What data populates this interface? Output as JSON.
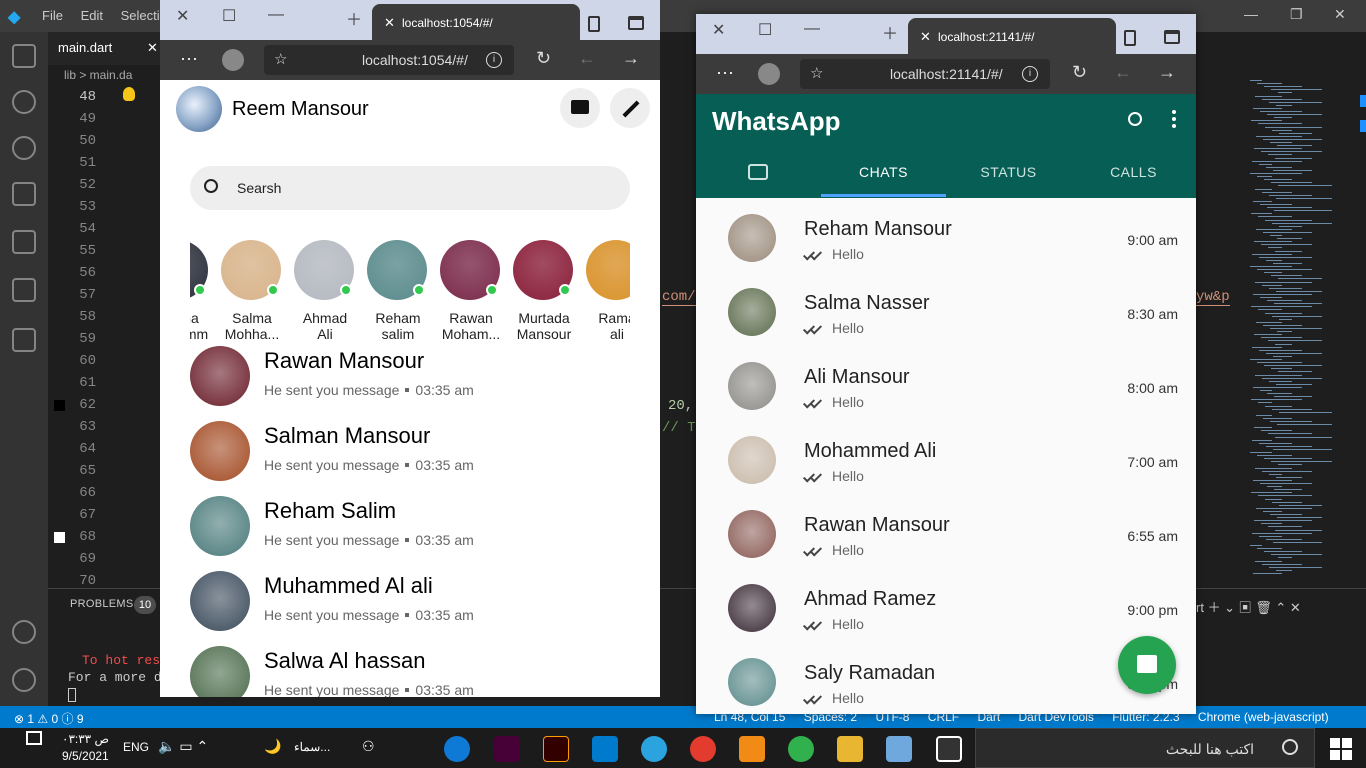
{
  "vscode": {
    "menu": [
      "File",
      "Edit",
      "Selectio"
    ],
    "tab": "main.dart",
    "breadcrumb": "lib > main.da",
    "line_numbers": [
      "48",
      "49",
      "50",
      "51",
      "52",
      "53",
      "54",
      "55",
      "56",
      "57",
      "58",
      "59",
      "60",
      "61",
      "62",
      "63",
      "64",
      "65",
      "66",
      "67",
      "68",
      "69",
      "70"
    ],
    "code_fragments": {
      "url_left": "com/",
      "url_right": "yw&p",
      "number": "20,",
      "comment": "// T"
    },
    "panel": {
      "problems_label": "PROBLEMS",
      "problems_count": "10",
      "terminal_line1": "To hot rest",
      "terminal_line2": "For a more de",
      "ctl_text": "rt"
    },
    "status_left": "⊗ 1 ⚠ 0 ⓘ 9",
    "status_right": [
      "Ln 48, Col 15",
      "Spaces: 2",
      "UTF-8",
      "CRLF",
      "Dart",
      "Dart DevTools",
      "Flutter: 2.2.3",
      "Chrome (web-javascript)"
    ]
  },
  "taskbar": {
    "time": "ص ٠٣:٣٣",
    "date": "9/5/2021",
    "lang": "ENG",
    "news": "سماء...",
    "search_placeholder": "اكتب هنا للبحث"
  },
  "browser1": {
    "tab_url": "localhost:1054/#/",
    "address": "localhost:1054/#/"
  },
  "browser2": {
    "tab_url": "localhost:21141/#/",
    "address": "localhost:21141/#/"
  },
  "messenger": {
    "user_name": "Reem Mansour",
    "search_placeholder": "Searsh",
    "stories": [
      {
        "l1": "Salma",
        "l2": "Mohamm",
        "color": "#2b2f3a"
      },
      {
        "l1": "Salma",
        "l2": "Mohha...",
        "color": "#d8b38a"
      },
      {
        "l1": "Ahmad",
        "l2": "Ali",
        "color": "#b4b8c0"
      },
      {
        "l1": "Reham",
        "l2": "salim",
        "color": "#5a8a8c"
      },
      {
        "l1": "Rawan",
        "l2": "Moham...",
        "color": "#7a2a4a"
      },
      {
        "l1": "Murtada",
        "l2": "Mansour",
        "color": "#8a1f3a"
      },
      {
        "l1": "Rama",
        "l2": "ali",
        "color": "#d9922a"
      }
    ],
    "chats": [
      {
        "name": "Rawan Mansour",
        "msg": "He sent you message",
        "time": "03:35 am",
        "color": "#6a1e2a"
      },
      {
        "name": "Salman Mansour",
        "msg": "He sent you message",
        "time": "03:35 am",
        "color": "#a24a22"
      },
      {
        "name": "Reham Salim",
        "msg": "He sent you message",
        "time": "03:35 am",
        "color": "#4a7a7a"
      },
      {
        "name": "Muhammed Al ali",
        "msg": "He sent you message",
        "time": "03:35 am",
        "color": "#3a4a5a"
      },
      {
        "name": "Salwa Al hassan",
        "msg": "He sent you message",
        "time": "03:35 am",
        "color": "#4a6a4a"
      }
    ]
  },
  "whatsapp": {
    "title": "WhatsApp",
    "tabs": [
      "CHATS",
      "STATUS",
      "CALLS"
    ],
    "active_tab": "CHATS",
    "chats": [
      {
        "name": "Reham Mansour",
        "msg": "Hello",
        "time": "9:00 am",
        "color": "#9a8a7a"
      },
      {
        "name": "Salma Nasser",
        "msg": "Hello",
        "time": "8:30 am",
        "color": "#5a6a4a"
      },
      {
        "name": "Ali Mansour",
        "msg": "Hello",
        "time": "8:00 am",
        "color": "#8c8a86"
      },
      {
        "name": "Mohammed Ali",
        "msg": "Hello",
        "time": "7:00 am",
        "color": "#c8b8a8"
      },
      {
        "name": "Rawan Mansour",
        "msg": "Hello",
        "time": "6:55 am",
        "color": "#8a5a54"
      },
      {
        "name": "Ahmad Ramez",
        "msg": "Hello",
        "time": "9:00 pm",
        "color": "#3a2a34"
      },
      {
        "name": "Saly Ramadan",
        "msg": "Hello",
        "time": "8:00 pm",
        "color": "#5a8a8a"
      }
    ],
    "fab_icon": "message-icon",
    "brand_color": "#075e54"
  }
}
